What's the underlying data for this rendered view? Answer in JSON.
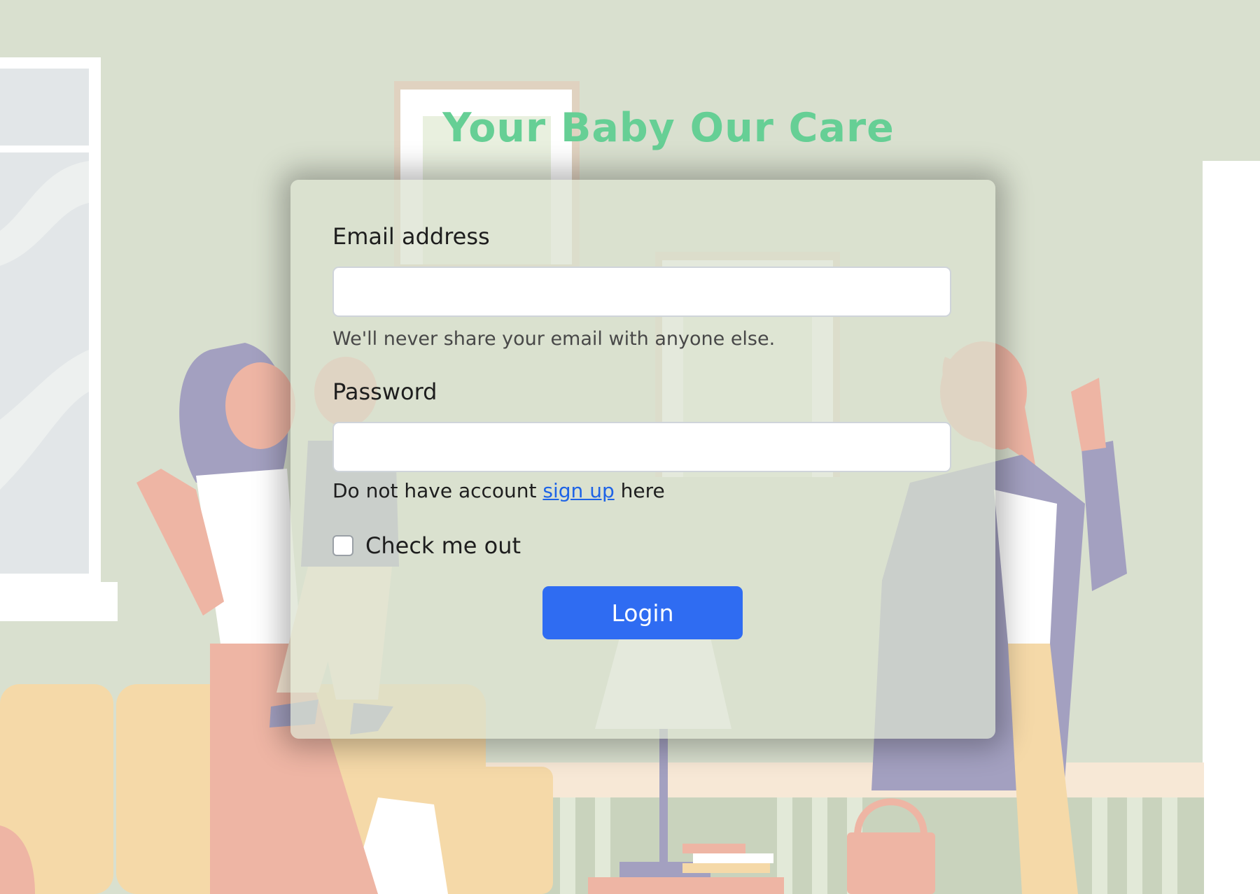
{
  "header": {
    "title": "Your Baby Our Care"
  },
  "form": {
    "email_label": "Email address",
    "email_value": "",
    "email_help": "We'll never share your email with anyone else.",
    "password_label": "Password",
    "password_value": "",
    "signup_prefix": "Do not have account",
    "signup_link": "sign up",
    "signup_suffix": "here",
    "remember_label": "Check me out",
    "remember_checked": false,
    "login_label": "Login"
  },
  "colors": {
    "title": "#66cf95",
    "button": "#2f6cf2",
    "link": "#1e63e6",
    "wall": "#d9e0cf",
    "sofa": "#f5d9a8",
    "skin": "#eeb5a4",
    "jacket": "#a3a0c0"
  }
}
